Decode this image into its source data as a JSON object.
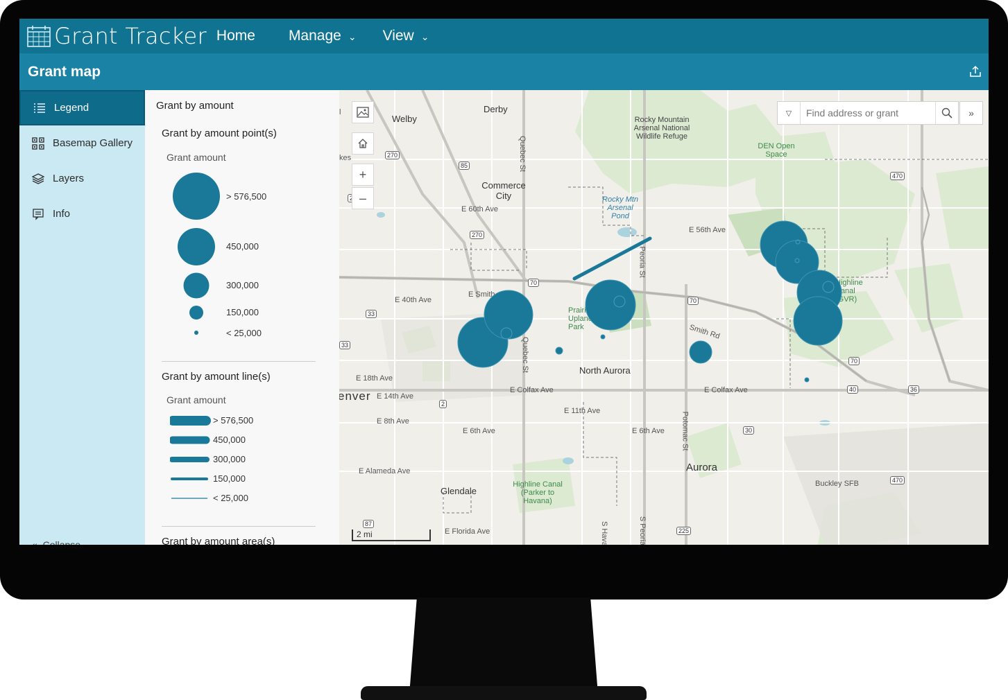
{
  "app": {
    "title": "Grant Tracker"
  },
  "nav": {
    "home": "Home",
    "manage": "Manage",
    "view": "View"
  },
  "page": {
    "title": "Grant map"
  },
  "sidebar": {
    "items": [
      {
        "label": "Legend",
        "icon": "legend-icon",
        "active": true
      },
      {
        "label": "Basemap Gallery",
        "icon": "basemap-gallery-icon",
        "active": false
      },
      {
        "label": "Layers",
        "icon": "layers-icon",
        "active": false
      },
      {
        "label": "Info",
        "icon": "info-icon",
        "active": false
      }
    ],
    "collapse": "Collapse"
  },
  "legend": {
    "title": "Grant by amount",
    "points": {
      "title": "Grant by amount point(s)",
      "field": "Grant amount",
      "classes": [
        "> 576,500",
        "450,000",
        "300,000",
        "150,000",
        "< 25,000"
      ]
    },
    "lines": {
      "title": "Grant by amount line(s)",
      "field": "Grant amount",
      "classes": [
        "> 576,500",
        "450,000",
        "300,000",
        "150,000",
        "< 25,000"
      ]
    },
    "areas": {
      "title": "Grant by amount area(s)"
    }
  },
  "search": {
    "placeholder": "Find address or grant"
  },
  "map": {
    "scale": "2 mi",
    "symbol_color": "#1a7899",
    "labels": {
      "derby": "Derby",
      "welby": "Welby",
      "commerce_city": "Commerce City",
      "rocky_mountain": "Rocky Mountain Arsenal National Wildlife Refuge",
      "rocky_mtn_pond": "Rocky Mtn Arsenal Pond",
      "den_open_space": "DEN Open Space",
      "e60th": "E 60th Ave",
      "e56th": "E 56th Ave",
      "e40th": "E 40th Ave",
      "smith": "Smith Rd",
      "e_smith": "E Smith",
      "prairie": "Prairie Uplands Park",
      "highline": "Highline Canal (GVR)",
      "north_aurora": "North Aurora",
      "e18th": "E 18th Ave",
      "e14th": "E 14th Ave",
      "colfax1": "E Colfax Ave",
      "colfax2": "E Colfax Ave",
      "e11th": "E 11th Ave",
      "e8th": "E 8th Ave",
      "e6th1": "E 6th Ave",
      "e6th2": "E 6th Ave",
      "denver": "enver",
      "alameda": "E Alameda Ave",
      "glendale": "Glendale",
      "highline2": "Highline Canal (Parker to Havana)",
      "aurora": "Aurora",
      "buckley": "Buckley SFB",
      "florida": "E Florida Ave",
      "quebec": "Quebec St",
      "quebec2": "Quebec St",
      "peoria": "Peoria St",
      "potomac": "Potomac St",
      "havana": "S Hava",
      "speoria": "S Peoria",
      "kes": "kes",
      "l": "l"
    },
    "shields": [
      "270",
      "85",
      "270",
      "70",
      "70",
      "33",
      "33",
      "2",
      "70",
      "40",
      "36",
      "30",
      "470",
      "470",
      "225",
      "87",
      "25"
    ]
  }
}
